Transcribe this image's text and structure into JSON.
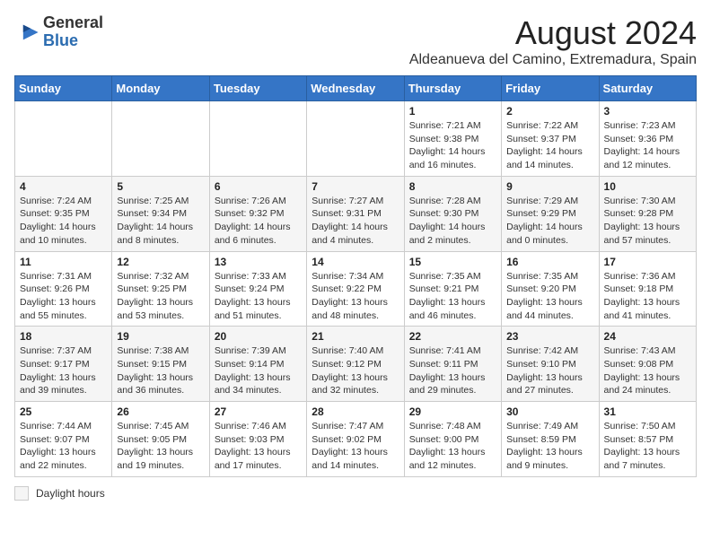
{
  "logo": {
    "text_general": "General",
    "text_blue": "Blue"
  },
  "title": "August 2024",
  "subtitle": "Aldeanueva del Camino, Extremadura, Spain",
  "days_of_week": [
    "Sunday",
    "Monday",
    "Tuesday",
    "Wednesday",
    "Thursday",
    "Friday",
    "Saturday"
  ],
  "weeks": [
    [
      {
        "num": "",
        "info": ""
      },
      {
        "num": "",
        "info": ""
      },
      {
        "num": "",
        "info": ""
      },
      {
        "num": "",
        "info": ""
      },
      {
        "num": "1",
        "info": "Sunrise: 7:21 AM\nSunset: 9:38 PM\nDaylight: 14 hours and 16 minutes."
      },
      {
        "num": "2",
        "info": "Sunrise: 7:22 AM\nSunset: 9:37 PM\nDaylight: 14 hours and 14 minutes."
      },
      {
        "num": "3",
        "info": "Sunrise: 7:23 AM\nSunset: 9:36 PM\nDaylight: 14 hours and 12 minutes."
      }
    ],
    [
      {
        "num": "4",
        "info": "Sunrise: 7:24 AM\nSunset: 9:35 PM\nDaylight: 14 hours and 10 minutes."
      },
      {
        "num": "5",
        "info": "Sunrise: 7:25 AM\nSunset: 9:34 PM\nDaylight: 14 hours and 8 minutes."
      },
      {
        "num": "6",
        "info": "Sunrise: 7:26 AM\nSunset: 9:32 PM\nDaylight: 14 hours and 6 minutes."
      },
      {
        "num": "7",
        "info": "Sunrise: 7:27 AM\nSunset: 9:31 PM\nDaylight: 14 hours and 4 minutes."
      },
      {
        "num": "8",
        "info": "Sunrise: 7:28 AM\nSunset: 9:30 PM\nDaylight: 14 hours and 2 minutes."
      },
      {
        "num": "9",
        "info": "Sunrise: 7:29 AM\nSunset: 9:29 PM\nDaylight: 14 hours and 0 minutes."
      },
      {
        "num": "10",
        "info": "Sunrise: 7:30 AM\nSunset: 9:28 PM\nDaylight: 13 hours and 57 minutes."
      }
    ],
    [
      {
        "num": "11",
        "info": "Sunrise: 7:31 AM\nSunset: 9:26 PM\nDaylight: 13 hours and 55 minutes."
      },
      {
        "num": "12",
        "info": "Sunrise: 7:32 AM\nSunset: 9:25 PM\nDaylight: 13 hours and 53 minutes."
      },
      {
        "num": "13",
        "info": "Sunrise: 7:33 AM\nSunset: 9:24 PM\nDaylight: 13 hours and 51 minutes."
      },
      {
        "num": "14",
        "info": "Sunrise: 7:34 AM\nSunset: 9:22 PM\nDaylight: 13 hours and 48 minutes."
      },
      {
        "num": "15",
        "info": "Sunrise: 7:35 AM\nSunset: 9:21 PM\nDaylight: 13 hours and 46 minutes."
      },
      {
        "num": "16",
        "info": "Sunrise: 7:35 AM\nSunset: 9:20 PM\nDaylight: 13 hours and 44 minutes."
      },
      {
        "num": "17",
        "info": "Sunrise: 7:36 AM\nSunset: 9:18 PM\nDaylight: 13 hours and 41 minutes."
      }
    ],
    [
      {
        "num": "18",
        "info": "Sunrise: 7:37 AM\nSunset: 9:17 PM\nDaylight: 13 hours and 39 minutes."
      },
      {
        "num": "19",
        "info": "Sunrise: 7:38 AM\nSunset: 9:15 PM\nDaylight: 13 hours and 36 minutes."
      },
      {
        "num": "20",
        "info": "Sunrise: 7:39 AM\nSunset: 9:14 PM\nDaylight: 13 hours and 34 minutes."
      },
      {
        "num": "21",
        "info": "Sunrise: 7:40 AM\nSunset: 9:12 PM\nDaylight: 13 hours and 32 minutes."
      },
      {
        "num": "22",
        "info": "Sunrise: 7:41 AM\nSunset: 9:11 PM\nDaylight: 13 hours and 29 minutes."
      },
      {
        "num": "23",
        "info": "Sunrise: 7:42 AM\nSunset: 9:10 PM\nDaylight: 13 hours and 27 minutes."
      },
      {
        "num": "24",
        "info": "Sunrise: 7:43 AM\nSunset: 9:08 PM\nDaylight: 13 hours and 24 minutes."
      }
    ],
    [
      {
        "num": "25",
        "info": "Sunrise: 7:44 AM\nSunset: 9:07 PM\nDaylight: 13 hours and 22 minutes."
      },
      {
        "num": "26",
        "info": "Sunrise: 7:45 AM\nSunset: 9:05 PM\nDaylight: 13 hours and 19 minutes."
      },
      {
        "num": "27",
        "info": "Sunrise: 7:46 AM\nSunset: 9:03 PM\nDaylight: 13 hours and 17 minutes."
      },
      {
        "num": "28",
        "info": "Sunrise: 7:47 AM\nSunset: 9:02 PM\nDaylight: 13 hours and 14 minutes."
      },
      {
        "num": "29",
        "info": "Sunrise: 7:48 AM\nSunset: 9:00 PM\nDaylight: 13 hours and 12 minutes."
      },
      {
        "num": "30",
        "info": "Sunrise: 7:49 AM\nSunset: 8:59 PM\nDaylight: 13 hours and 9 minutes."
      },
      {
        "num": "31",
        "info": "Sunrise: 7:50 AM\nSunset: 8:57 PM\nDaylight: 13 hours and 7 minutes."
      }
    ]
  ],
  "footer": {
    "label": "Daylight hours"
  }
}
